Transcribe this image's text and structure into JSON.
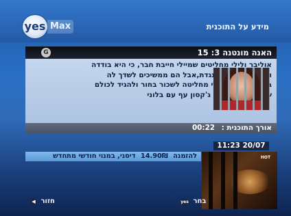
{
  "header": {
    "logo_yes": "yes",
    "logo_max": "Max",
    "title": "מידע על התוכנית"
  },
  "program": {
    "rating": "G",
    "title": "האנה מונטנה 3:  15",
    "description": "אוליבר ולילי מחליטים שמיילי חייבת חבר, כי היא בודדה ועצובה. מיילי מתנגדת,אבל הם ממשיכים לשדך לה בחורים, עד שמיילי מחליטה לשכור בחור ולהגיד לכולם שהוא החבר שלה. ג'קסון עף עם בלוני",
    "duration_label": "אורך התוכנית :",
    "duration_value": "00:22"
  },
  "clock": "11:23 20/07",
  "vod_offer": {
    "order": "להזמנה",
    "price": "14.90₪",
    "text": "דיסני, במנוי חודשי מתחדש"
  },
  "preview": {
    "channel_badge": "HOT"
  },
  "footer": {
    "back_label": "חזור",
    "select_label": "בחר",
    "back_icon": "back-button-icon",
    "select_icon": "yes-button-icon"
  },
  "colors": {
    "panel_bg": "#b8cde8",
    "titlebar_bg": "#111520",
    "vod_bar": "#6aa6e0"
  }
}
